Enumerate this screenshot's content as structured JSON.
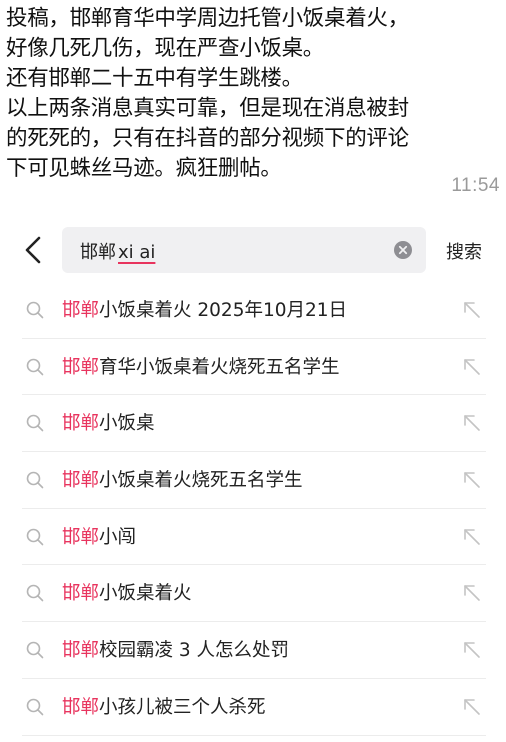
{
  "message": {
    "lines": [
      "投稿，邯郸育华中学周边托管小饭桌着火，",
      "好像几死几伤，现在严查小饭桌。",
      "还有邯郸二十五中有学生跳楼。",
      "以上两条消息真实可靠，但是现在消息被封",
      "的死死的，只有在抖音的部分视频下的评论",
      "下可见蛛丝马迹。疯狂删帖。"
    ],
    "time": "11:54"
  },
  "search": {
    "query_prefix": "邯郸",
    "query_pinyin": "xi ai",
    "submit_label": "搜索",
    "back_icon": "chevron-left-icon",
    "clear_icon": "clear-circle-icon"
  },
  "suggestions": [
    {
      "highlight": "邯郸",
      "rest": "小饭桌着火 2025年10月21日"
    },
    {
      "highlight": "邯郸",
      "rest": "育华小饭桌着火烧死五名学生"
    },
    {
      "highlight": "邯郸",
      "rest": "小饭桌"
    },
    {
      "highlight": "邯郸",
      "rest": "小饭桌着火烧死五名学生"
    },
    {
      "highlight": "邯郸",
      "rest": "小闯"
    },
    {
      "highlight": "邯郸",
      "rest": "小饭桌着火"
    },
    {
      "highlight": "邯郸",
      "rest": "校园霸凌 3 人怎么处罚"
    },
    {
      "highlight": "邯郸",
      "rest": "小孩儿被三个人杀死"
    }
  ],
  "colors": {
    "highlight": "#e8345e",
    "text": "#222222",
    "muted": "#9a9a9a",
    "search_bg": "#f0f0f2"
  },
  "icons": {
    "suggestion_leading": "search-icon",
    "suggestion_trailing": "arrow-up-left-icon"
  }
}
